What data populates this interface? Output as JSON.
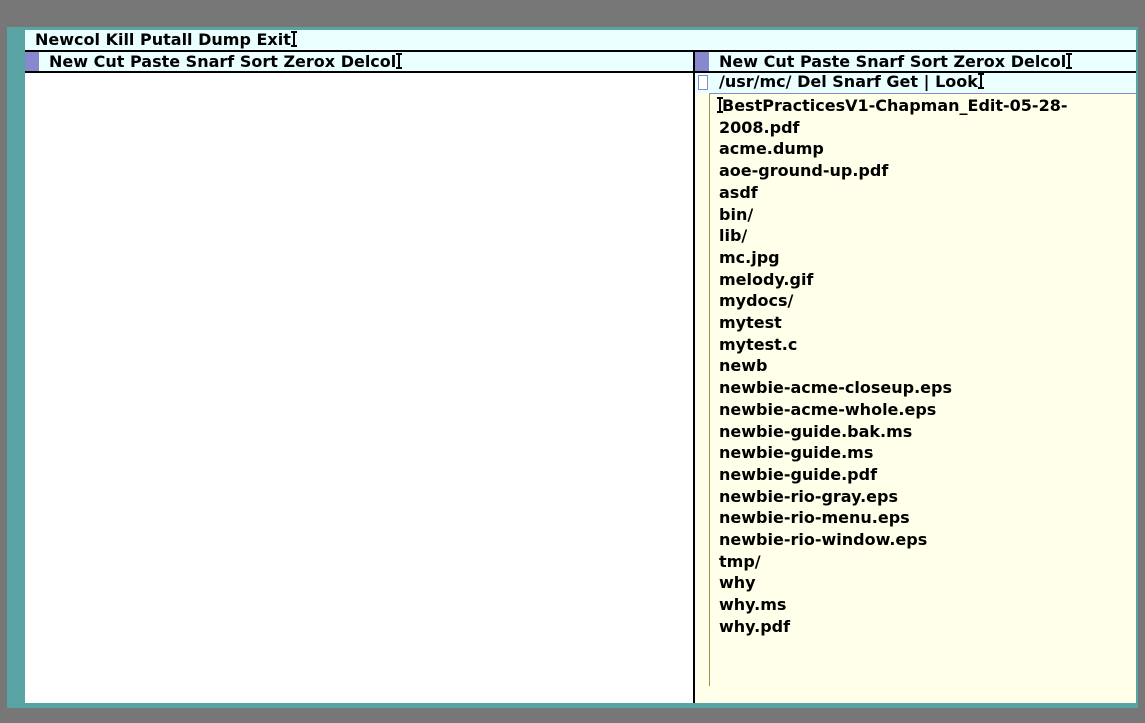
{
  "row_tag": {
    "commands": [
      "Newcol",
      "Kill",
      "Putall",
      "Dump",
      "Exit"
    ]
  },
  "left_column": {
    "tag_commands": [
      "New",
      "Cut",
      "Paste",
      "Snarf",
      "Sort",
      "Zerox",
      "Delcol"
    ]
  },
  "right_column": {
    "tag_commands": [
      "New",
      "Cut",
      "Paste",
      "Snarf",
      "Sort",
      "Zerox",
      "Delcol"
    ],
    "window": {
      "path": "/usr/mc/",
      "commands": [
        "Del",
        "Snarf",
        "Get",
        "|",
        "Look"
      ],
      "files": [
        "BestPracticesV1-Chapman_Edit-05-28-",
        "2008.pdf",
        "acme.dump",
        "aoe-ground-up.pdf",
        "asdf",
        "bin/",
        "lib/",
        "mc.jpg",
        "melody.gif",
        "mydocs/",
        "mytest",
        "mytest.c",
        "newb",
        "newbie-acme-closeup.eps",
        "newbie-acme-whole.eps",
        "newbie-guide.bak.ms",
        "newbie-guide.ms",
        "newbie-guide.pdf",
        "newbie-rio-gray.eps",
        "newbie-rio-menu.eps",
        "newbie-rio-window.eps",
        "tmp/",
        "why",
        "why.ms",
        "why.pdf"
      ]
    }
  },
  "colors": {
    "background": "#777777",
    "border": "#58a4a4",
    "tag": "#eaffff",
    "body": "#ffffea",
    "box": "#8888cc"
  }
}
